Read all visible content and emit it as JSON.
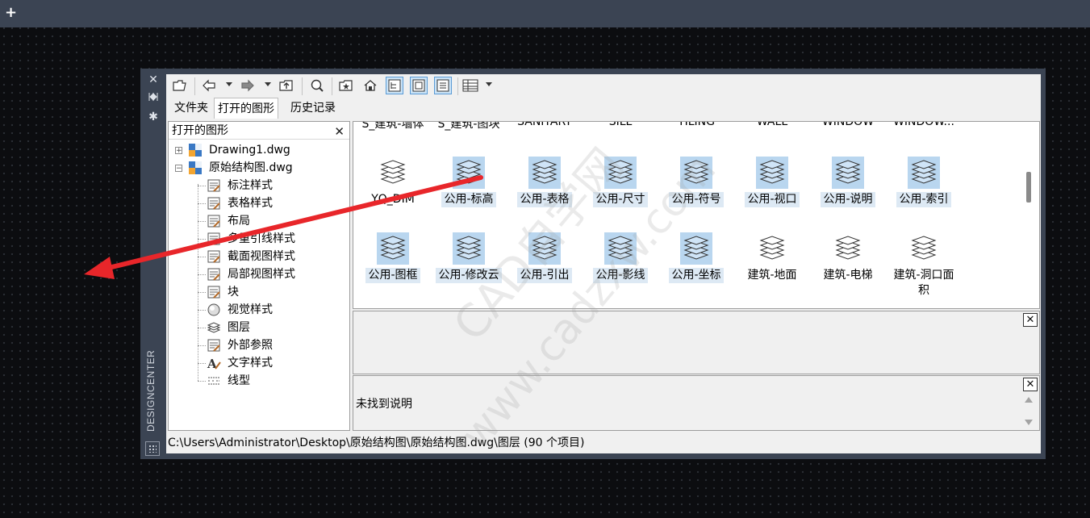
{
  "app": {
    "add_symbol": "+",
    "panel_title": "DESIGNCENTER"
  },
  "toolbar": {
    "buttons": [
      {
        "name": "open-icon"
      },
      {
        "name": "back-icon"
      },
      {
        "name": "forward-icon"
      },
      {
        "name": "up-icon"
      },
      {
        "name": "search-icon"
      },
      {
        "name": "favorites-icon"
      },
      {
        "name": "home-icon"
      },
      {
        "name": "tree-toggle-icon",
        "active": true
      },
      {
        "name": "preview-icon",
        "active": true
      },
      {
        "name": "description-icon",
        "active": true
      },
      {
        "name": "views-icon"
      }
    ]
  },
  "tabs": [
    "文件夹",
    "打开的图形",
    "历史记录"
  ],
  "active_tab": 1,
  "tree": {
    "header": "打开的图形",
    "close_symbol": "✕",
    "nodes": [
      {
        "label": "Drawing1.dwg",
        "level": 0,
        "expander": "+",
        "icon": "dwg-icon"
      },
      {
        "label": "原始结构图.dwg",
        "level": 0,
        "expander": "−",
        "icon": "dwg-icon"
      },
      {
        "label": "标注样式",
        "level": 1,
        "icon": "dimstyle-icon"
      },
      {
        "label": "表格样式",
        "level": 1,
        "icon": "tablestyle-icon"
      },
      {
        "label": "布局",
        "level": 1,
        "icon": "layout-icon"
      },
      {
        "label": "多重引线样式",
        "level": 1,
        "icon": "mleader-icon"
      },
      {
        "label": "截面视图样式",
        "level": 1,
        "icon": "sectionview-icon"
      },
      {
        "label": "局部视图样式",
        "level": 1,
        "icon": "detailview-icon"
      },
      {
        "label": "块",
        "level": 1,
        "icon": "block-icon"
      },
      {
        "label": "视觉样式",
        "level": 1,
        "icon": "visualstyle-icon"
      },
      {
        "label": "图层",
        "level": 1,
        "icon": "layers-icon"
      },
      {
        "label": "外部参照",
        "level": 1,
        "icon": "xref-icon"
      },
      {
        "label": "文字样式",
        "level": 1,
        "icon": "textstyle-icon"
      },
      {
        "label": "线型",
        "level": 1,
        "icon": "linetype-icon"
      }
    ]
  },
  "content": {
    "partial_row": [
      "S_建筑-墙体",
      "S_建筑-图块",
      "SANITARY",
      "SILL",
      "TILING",
      "WALL",
      "WINDOW",
      "WINDOW..."
    ],
    "rows": [
      [
        {
          "label": "YQ_DIM",
          "selected": false
        },
        {
          "label": "公用-标高",
          "selected": true
        },
        {
          "label": "公用-表格",
          "selected": true
        },
        {
          "label": "公用-尺寸",
          "selected": true
        },
        {
          "label": "公用-符号",
          "selected": true
        },
        {
          "label": "公用-视口",
          "selected": true
        },
        {
          "label": "公用-说明",
          "selected": true
        },
        {
          "label": "公用-索引",
          "selected": true
        }
      ],
      [
        {
          "label": "公用-图框",
          "selected": true
        },
        {
          "label": "公用-修改云",
          "selected": true
        },
        {
          "label": "公用-引出",
          "selected": true
        },
        {
          "label": "公用-影线",
          "selected": true
        },
        {
          "label": "公用-坐标",
          "selected": true
        },
        {
          "label": "建筑-地面",
          "selected": false
        },
        {
          "label": "建筑-电梯",
          "selected": false
        },
        {
          "label": "建筑-洞口面积",
          "selected": false
        }
      ]
    ]
  },
  "preview": {
    "close_symbol": "✕"
  },
  "description": {
    "close_symbol": "✕",
    "text": "未找到说明"
  },
  "status": "C:\\Users\\Administrator\\Desktop\\原始结构图\\原始结构图.dwg\\图层 (90 个项目)",
  "watermark": {
    "line1": "CAD自学网",
    "line2": "www.cadzxw.com"
  },
  "colors": {
    "annotation_arrow": "#e8262a",
    "selection": "#b9d6ef",
    "frame": "#3b4453"
  }
}
